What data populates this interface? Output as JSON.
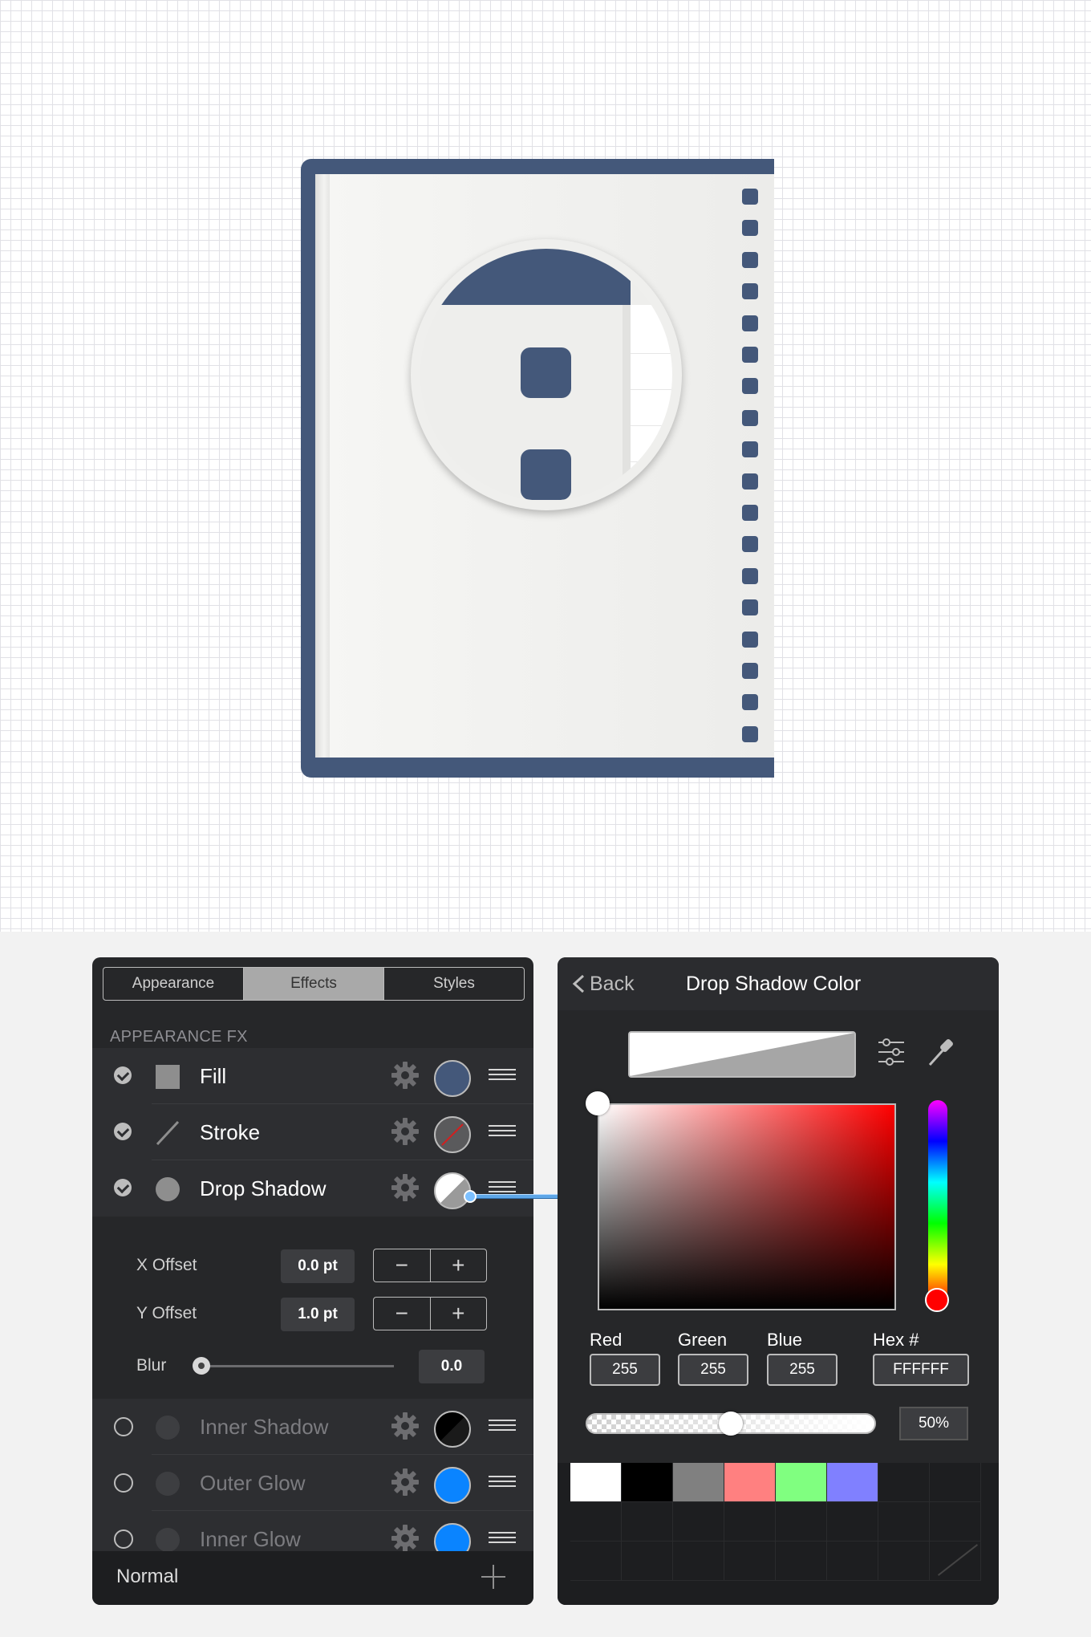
{
  "left_panel": {
    "tabs": [
      {
        "label": "Appearance",
        "active": false
      },
      {
        "label": "Effects",
        "active": true
      },
      {
        "label": "Styles",
        "active": false
      }
    ],
    "section_label": "APPEARANCE FX",
    "effects": [
      {
        "label": "Fill",
        "enabled": true,
        "icon": "fill-square-icon",
        "swatch": "#44587a"
      },
      {
        "label": "Stroke",
        "enabled": true,
        "icon": "stroke-line-icon",
        "swatch": "none"
      },
      {
        "label": "Drop Shadow",
        "enabled": true,
        "icon": "shadow-circle-icon",
        "swatch": "#ffffff"
      },
      {
        "label": "Inner Shadow",
        "enabled": false,
        "icon": "shadow-circle-icon",
        "swatch": "#000000"
      },
      {
        "label": "Outer Glow",
        "enabled": false,
        "icon": "shadow-circle-icon",
        "swatch": "#0a84ff"
      },
      {
        "label": "Inner Glow",
        "enabled": false,
        "icon": "shadow-circle-icon",
        "swatch": "#0a84ff"
      }
    ],
    "options": {
      "x_offset_label": "X Offset",
      "x_offset_value": "0.0 pt",
      "y_offset_label": "Y Offset",
      "y_offset_value": "1.0 pt",
      "blur_label": "Blur",
      "blur_value": "0.0",
      "minus": "−",
      "plus": "+"
    },
    "blend_mode": "Normal"
  },
  "right_panel": {
    "back_label": "Back",
    "title": "Drop Shadow Color",
    "channels": [
      {
        "label": "Red",
        "value": "255"
      },
      {
        "label": "Green",
        "value": "255"
      },
      {
        "label": "Blue",
        "value": "255"
      },
      {
        "label": "Hex #",
        "value": "FFFFFF"
      }
    ],
    "opacity": "50%",
    "palette": [
      "#ffffff",
      "#000000",
      "#808080",
      "#ff8080",
      "#80ff80",
      "#8080ff"
    ]
  },
  "colors": {
    "frame": "#44587a",
    "panel_bg": "#262729",
    "accent_blue": "#0a84ff"
  }
}
